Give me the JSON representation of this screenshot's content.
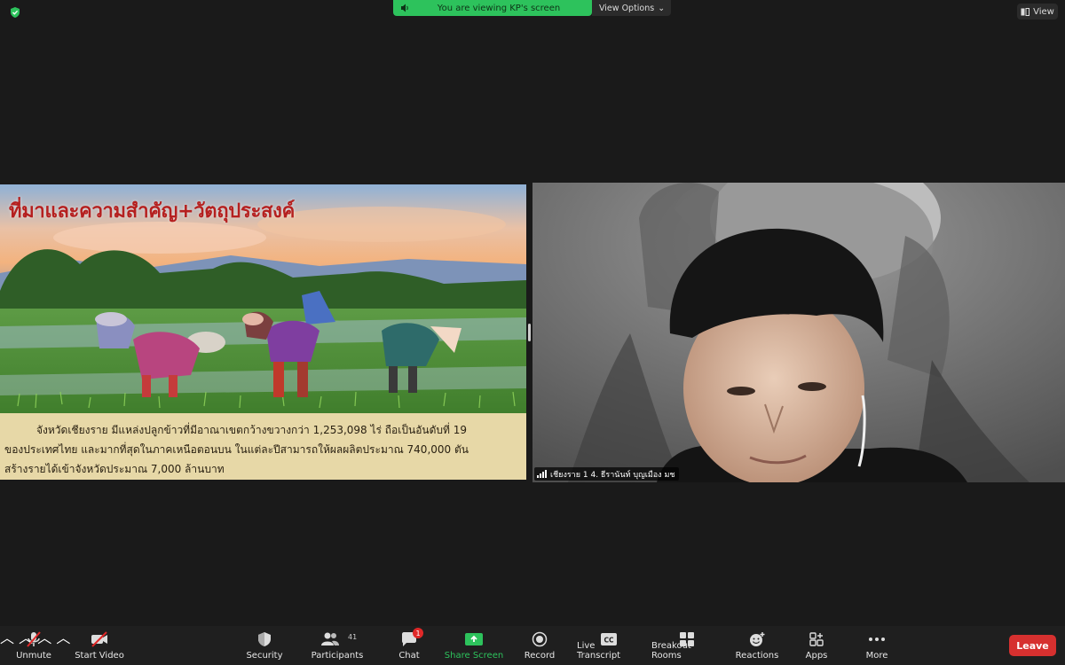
{
  "top": {
    "banner_text": "You are viewing KP's screen",
    "view_options_label": "View Options",
    "view_label": "View"
  },
  "slide": {
    "title": "ที่มาและความสำคัญ+วัตถุประสงค์",
    "lines": [
      "จังหวัดเชียงราย มีแหล่งปลูกข้าวที่มีอาณาเขตกว้างขวางกว่า 1,253,098 ไร่ ถือเป็นอันดับที่ 19",
      "ของประเทศไทย และมากที่สุดในภาคเหนือตอนบน ในแต่ละปีสามารถให้ผลผลิตประมาณ 740,000 ตัน",
      "สร้างรายได้เข้าจังหวัดประมาณ 7,000 ล้านบาท"
    ]
  },
  "participant": {
    "name": "เชียงราย 1 4. ธีรานันท์ บุญเมือง มช"
  },
  "toolbar": {
    "unmute": "Unmute",
    "start_video": "Start Video",
    "security": "Security",
    "participants": "Participants",
    "participants_count": "41",
    "chat": "Chat",
    "chat_unread": "1",
    "share_screen": "Share Screen",
    "record": "Record",
    "live_transcript": "Live Transcript",
    "breakout_rooms": "Breakout Rooms",
    "reactions": "Reactions",
    "apps": "Apps",
    "more": "More",
    "leave": "Leave"
  },
  "colors": {
    "accent_green": "#2dc25c",
    "leave_red": "#d6302f",
    "title_red": "#b5201f"
  }
}
